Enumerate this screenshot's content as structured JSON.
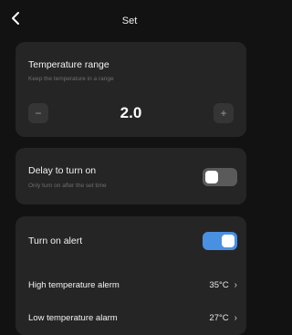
{
  "header": {
    "title": "Set",
    "back_icon": "chevron-left-icon"
  },
  "temperature_range": {
    "label": "Temperature range",
    "description": "Keep the temperature in a range",
    "decrement_label": "−",
    "increment_label": "+",
    "value": "2.0"
  },
  "delay": {
    "label": "Delay to turn on",
    "description": "Only turn on after the set time",
    "enabled": false
  },
  "alert": {
    "label": "Turn on alert",
    "enabled": true,
    "toggle_color": "#4a90e2",
    "rows": [
      {
        "label": "High temperature alerm",
        "value": "35°C",
        "chevron": "›"
      },
      {
        "label": "Low temperature alarm",
        "value": "27°C",
        "chevron": "›"
      }
    ]
  }
}
